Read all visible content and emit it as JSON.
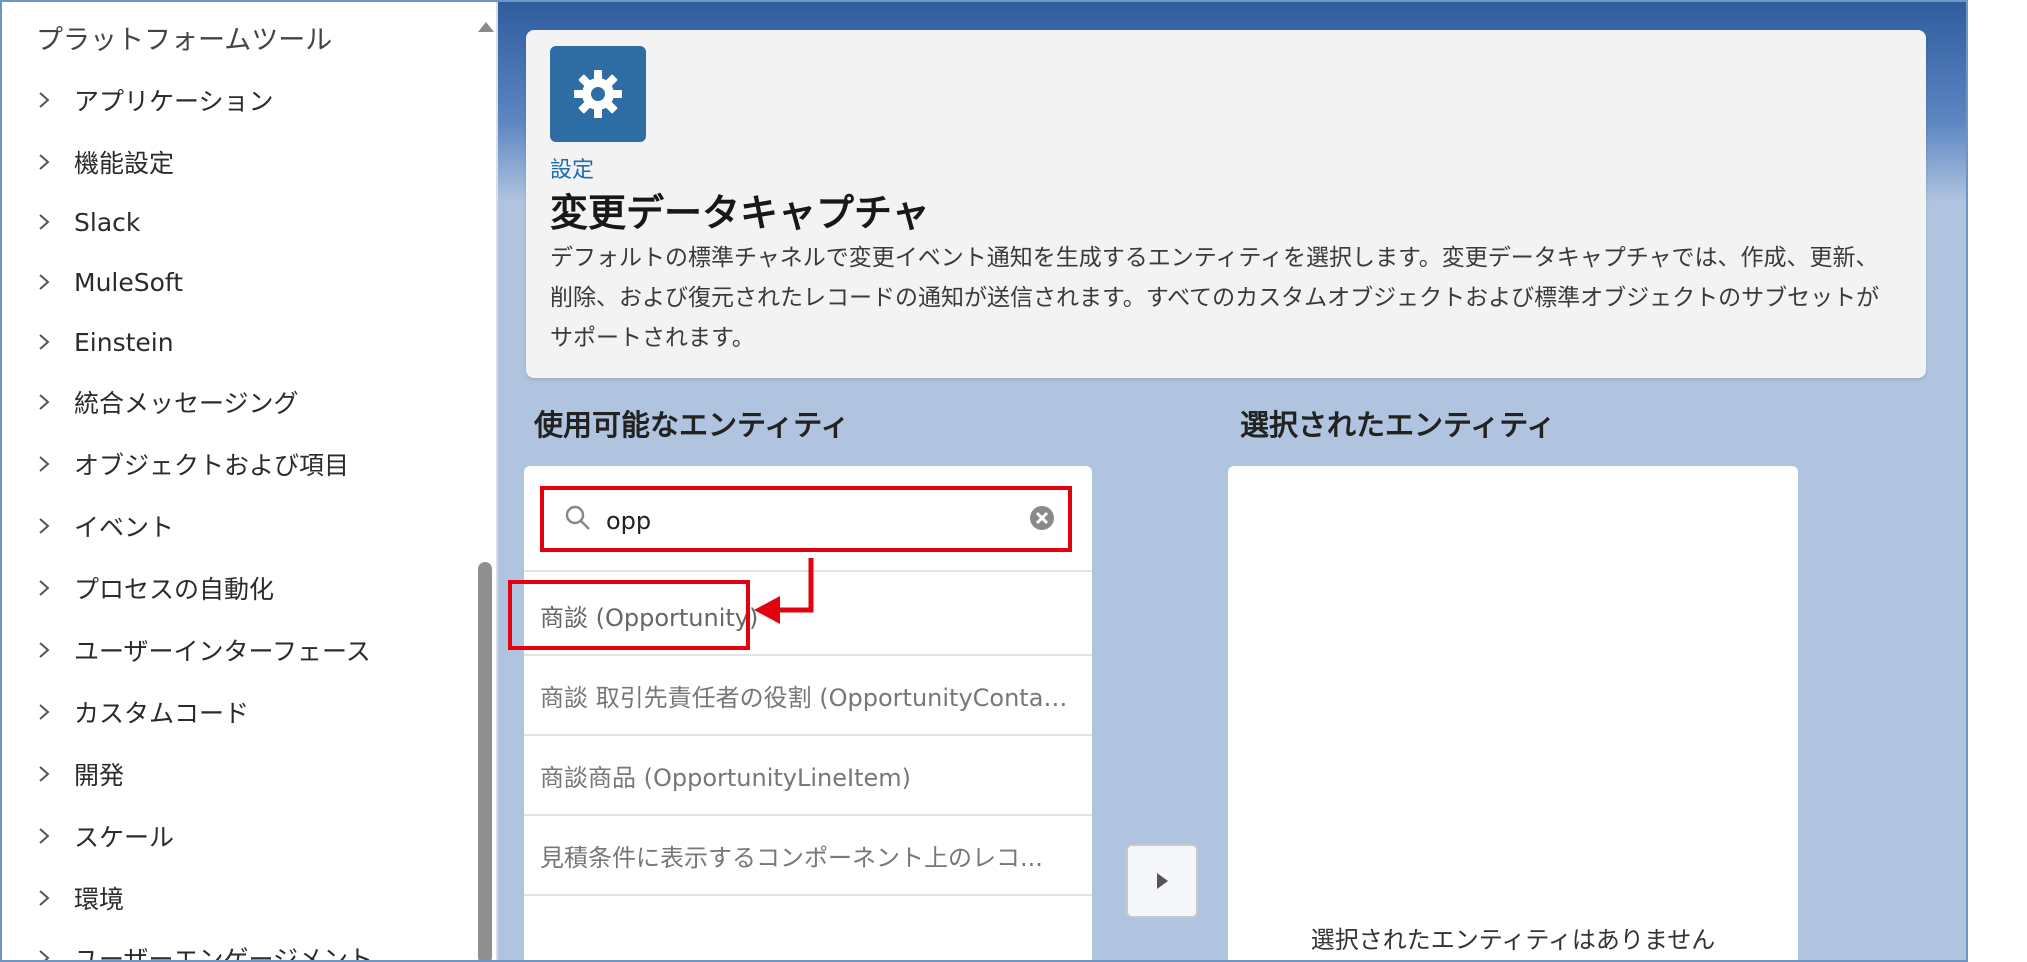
{
  "sidebar": {
    "header": "プラットフォームツール",
    "items": [
      {
        "label": "アプリケーション"
      },
      {
        "label": "機能設定"
      },
      {
        "label": "Slack"
      },
      {
        "label": "MuleSoft"
      },
      {
        "label": "Einstein"
      },
      {
        "label": "統合メッセージング"
      },
      {
        "label": "オブジェクトおよび項目"
      },
      {
        "label": "イベント"
      },
      {
        "label": "プロセスの自動化"
      },
      {
        "label": "ユーザーインターフェース"
      },
      {
        "label": "カスタムコード"
      },
      {
        "label": "開発"
      },
      {
        "label": "スケール"
      },
      {
        "label": "環境"
      },
      {
        "label": "ユーザーエンゲージメント"
      }
    ]
  },
  "header": {
    "icon": "gear-icon",
    "breadcrumb": "設定",
    "title": "変更データキャプチャ",
    "description": "デフォルトの標準チャネルで変更イベント通知を生成するエンティティを選択します。変更データキャプチャでは、作成、更新、削除、および復元されたレコードの通知が送信されます。すべてのカスタムオブジェクトおよび標準オブジェクトのサブセットがサポートされます。"
  },
  "available": {
    "heading": "使用可能なエンティティ",
    "search_value": "opp",
    "items": [
      {
        "label": "商談 (Opportunity)"
      },
      {
        "label": "商談 取引先責任者の役割 (OpportunityContac..."
      },
      {
        "label": "商談商品 (OpportunityLineItem)"
      },
      {
        "label": "見積条件に表示するコンポーネント上のレコ..."
      }
    ]
  },
  "selected": {
    "heading": "選択されたエンティティ",
    "empty_text": "選択されたエンティティはありません"
  },
  "colors": {
    "accent_red": "#e3000f",
    "gear_tile": "#2e6da4",
    "link_blue": "#1b6cb3",
    "main_background": "#b0c4df"
  }
}
